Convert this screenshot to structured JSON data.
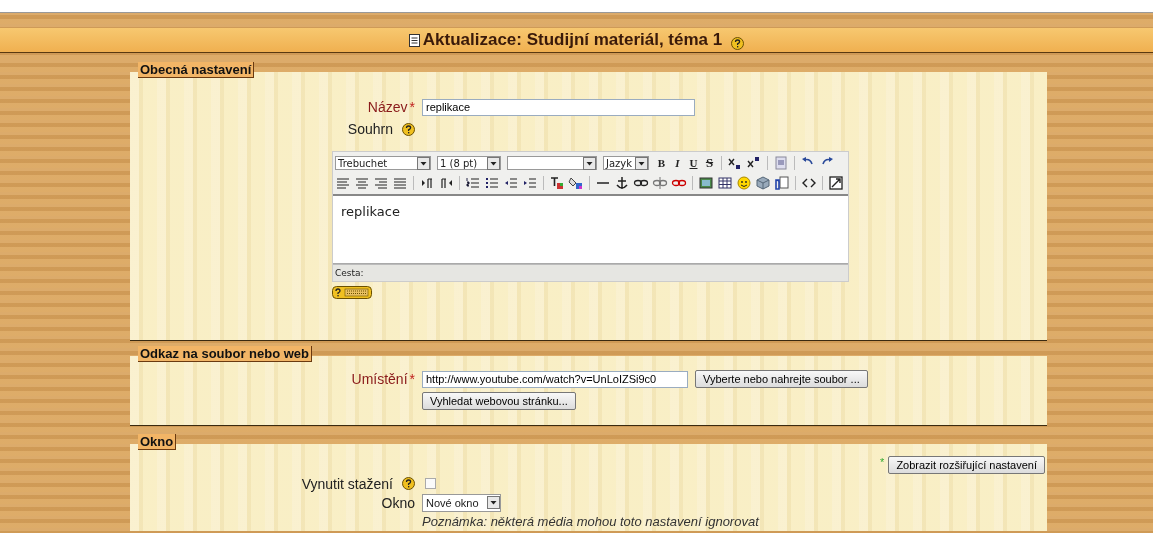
{
  "page_title": "Aktualizace: Studijní materiál, téma 1",
  "general": {
    "legend": "Obecná nastavení",
    "name_field": {
      "label": "Název",
      "required_mark": "*",
      "value": "replikace"
    },
    "summary": {
      "label": "Souhrn",
      "editor": {
        "font": "Trebuchet",
        "size": "1 (8 pt)",
        "language": "Jazyk",
        "format_buttons": [
          "B",
          "I",
          "U",
          "S"
        ],
        "content": "replikace",
        "path_label": "Cesta:"
      }
    }
  },
  "link": {
    "legend": "Odkaz na soubor nebo web",
    "location": {
      "label": "Umístění",
      "required_mark": "*",
      "value": "http://www.youtube.com/watch?v=UnLoIZSi9c0"
    },
    "buttons": [
      "Vyberte nebo nahrejte soubor ...",
      "Vyhledat webovou stránku..."
    ]
  },
  "window": {
    "legend": "Okno",
    "advanced_mark": "*",
    "advanced_button": "Zobrazit rozšiřující nastavení",
    "force_download": {
      "label": "Vynutit stažení",
      "checked": false
    },
    "window_select": {
      "label": "Okno",
      "value": "Nové okno"
    },
    "note": "Poznámka: některá média mohou toto nastavení ignorovat"
  }
}
